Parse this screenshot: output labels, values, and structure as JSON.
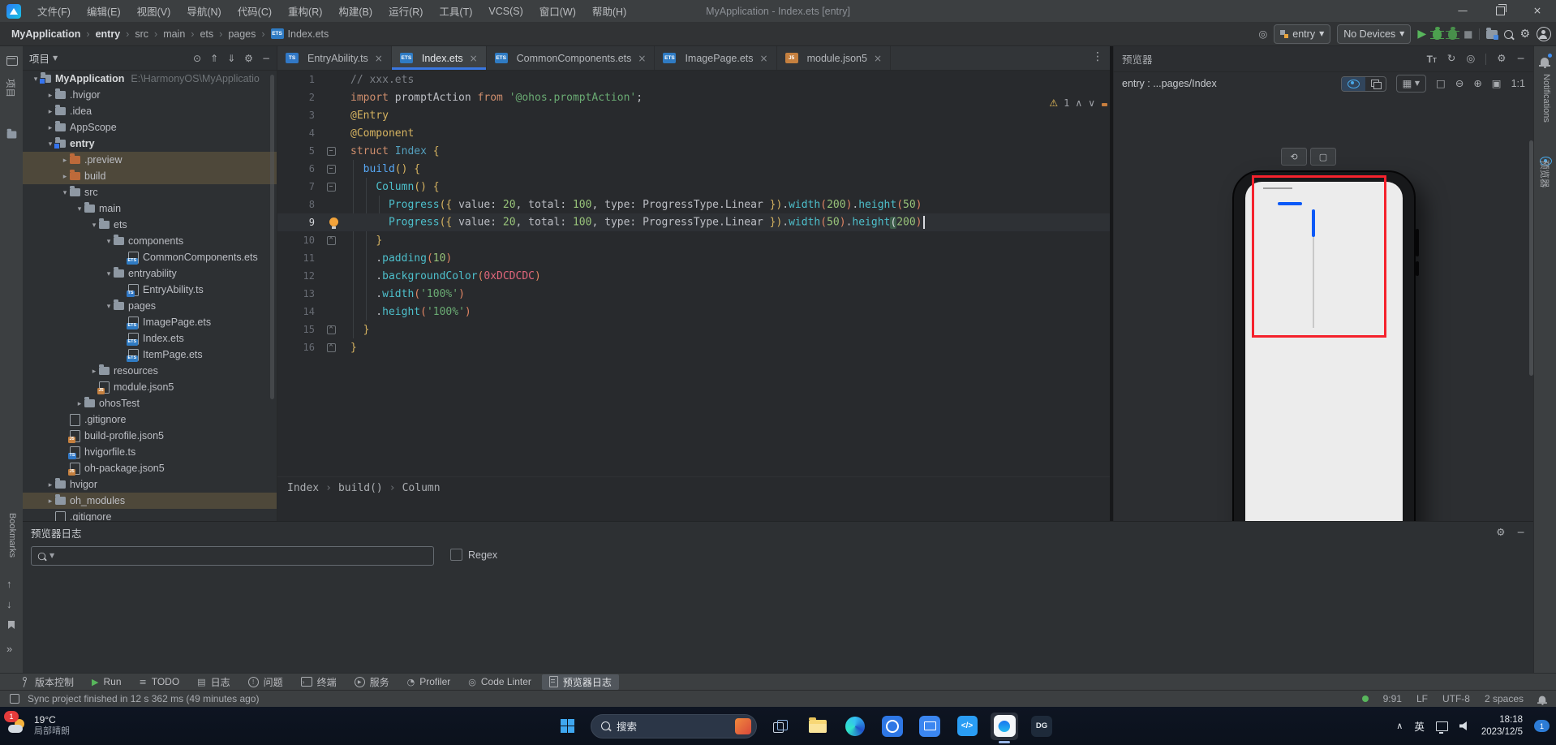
{
  "window": {
    "title": "MyApplication - Index.ets [entry]"
  },
  "menu": {
    "items": [
      "文件(F)",
      "编辑(E)",
      "视图(V)",
      "导航(N)",
      "代码(C)",
      "重构(R)",
      "构建(B)",
      "运行(R)",
      "工具(T)",
      "VCS(S)",
      "窗口(W)",
      "帮助(H)"
    ]
  },
  "toolbar": {
    "module": "entry",
    "device": "No Devices"
  },
  "breadcrumbs": {
    "items": [
      "MyApplication",
      "entry",
      "src",
      "main",
      "ets",
      "pages",
      "Index.ets"
    ]
  },
  "left_strip": {
    "project_label": "项目",
    "bookmarks_label": "Bookmarks"
  },
  "right_strip": {
    "notifications_label": "Notifications",
    "previewer_label": "预览器"
  },
  "project": {
    "header": "项目",
    "items": [
      {
        "label": "MyApplication",
        "indent": 0,
        "chev": "open",
        "icon": "folder-module",
        "bold": true,
        "path": "E:\\HarmonyOS\\MyApplicatio"
      },
      {
        "label": ".hvigor",
        "indent": 1,
        "chev": "closed",
        "icon": "folder"
      },
      {
        "label": ".idea",
        "indent": 1,
        "chev": "closed",
        "icon": "folder"
      },
      {
        "label": "AppScope",
        "indent": 1,
        "chev": "closed",
        "icon": "folder"
      },
      {
        "label": "entry",
        "indent": 1,
        "chev": "open",
        "icon": "folder-module",
        "bold": true
      },
      {
        "label": ".preview",
        "indent": 2,
        "chev": "closed",
        "icon": "folder-orange",
        "sel": true
      },
      {
        "label": "build",
        "indent": 2,
        "chev": "closed",
        "icon": "folder-orange",
        "sel": true
      },
      {
        "label": "src",
        "indent": 2,
        "chev": "open",
        "icon": "folder"
      },
      {
        "label": "main",
        "indent": 3,
        "chev": "open",
        "icon": "folder"
      },
      {
        "label": "ets",
        "indent": 4,
        "chev": "open",
        "icon": "folder"
      },
      {
        "label": "components",
        "indent": 5,
        "chev": "open",
        "icon": "folder"
      },
      {
        "label": "CommonComponents.ets",
        "indent": 6,
        "chev": null,
        "icon": "file-ets"
      },
      {
        "label": "entryability",
        "indent": 5,
        "chev": "open",
        "icon": "folder"
      },
      {
        "label": "EntryAbility.ts",
        "indent": 6,
        "chev": null,
        "icon": "file-ts"
      },
      {
        "label": "pages",
        "indent": 5,
        "chev": "open",
        "icon": "folder"
      },
      {
        "label": "ImagePage.ets",
        "indent": 6,
        "chev": null,
        "icon": "file-ets"
      },
      {
        "label": "Index.ets",
        "indent": 6,
        "chev": null,
        "icon": "file-ets"
      },
      {
        "label": "ItemPage.ets",
        "indent": 6,
        "chev": null,
        "icon": "file-ets"
      },
      {
        "label": "resources",
        "indent": 4,
        "chev": "closed",
        "icon": "folder"
      },
      {
        "label": "module.json5",
        "indent": 4,
        "chev": null,
        "icon": "file-json"
      },
      {
        "label": "ohosTest",
        "indent": 3,
        "chev": "closed",
        "icon": "folder"
      },
      {
        "label": ".gitignore",
        "indent": 2,
        "chev": null,
        "icon": "file-plain"
      },
      {
        "label": "build-profile.json5",
        "indent": 2,
        "chev": null,
        "icon": "file-json"
      },
      {
        "label": "hvigorfile.ts",
        "indent": 2,
        "chev": null,
        "icon": "file-ts"
      },
      {
        "label": "oh-package.json5",
        "indent": 2,
        "chev": null,
        "icon": "file-json"
      },
      {
        "label": "hvigor",
        "indent": 1,
        "chev": "closed",
        "icon": "folder"
      },
      {
        "label": "oh_modules",
        "indent": 1,
        "chev": "closed",
        "icon": "folder",
        "sel": true
      },
      {
        "label": ".gitignore",
        "indent": 1,
        "chev": null,
        "icon": "file-plain"
      }
    ]
  },
  "tabs": {
    "items": [
      {
        "label": "EntryAbility.ts",
        "icon": "ts",
        "active": false
      },
      {
        "label": "Index.ets",
        "icon": "ets",
        "active": true
      },
      {
        "label": "CommonComponents.ets",
        "icon": "ets",
        "active": false
      },
      {
        "label": "ImagePage.ets",
        "icon": "ets",
        "active": false
      },
      {
        "label": "module.json5",
        "icon": "json",
        "active": false
      }
    ]
  },
  "editor": {
    "warning_count": "1",
    "breadcrumb": [
      "Index",
      "build()",
      "Column"
    ],
    "lines": [
      {
        "n": 1,
        "t": [
          [
            "c",
            "// xxx.ets"
          ]
        ]
      },
      {
        "n": 2,
        "t": [
          [
            "k",
            "import"
          ],
          [
            "d",
            " promptAction "
          ],
          [
            "k",
            "from"
          ],
          [
            "d",
            " "
          ],
          [
            "s",
            "'@ohos.promptAction'"
          ],
          [
            "d",
            ";"
          ]
        ]
      },
      {
        "n": 3,
        "t": [
          [
            "a",
            "@Entry"
          ]
        ]
      },
      {
        "n": 4,
        "t": [
          [
            "a",
            "@Component"
          ]
        ]
      },
      {
        "n": 5,
        "fold": "minus",
        "t": [
          [
            "k",
            "struct"
          ],
          [
            "d",
            " "
          ],
          [
            "t",
            "Index"
          ],
          [
            "d",
            " "
          ],
          [
            "g",
            "{"
          ]
        ]
      },
      {
        "n": 6,
        "fold": "minus",
        "t": [
          [
            "d",
            "  "
          ],
          [
            "f",
            "build"
          ],
          [
            "g",
            "()"
          ],
          [
            "d",
            " "
          ],
          [
            "g",
            "{"
          ]
        ]
      },
      {
        "n": 7,
        "fold": "minus",
        "t": [
          [
            "d",
            "    "
          ],
          [
            "m",
            "Column"
          ],
          [
            "g",
            "()"
          ],
          [
            "d",
            " "
          ],
          [
            "g",
            "{"
          ]
        ]
      },
      {
        "n": 8,
        "t": [
          [
            "d",
            "      "
          ],
          [
            "m",
            "Progress"
          ],
          [
            "g",
            "({"
          ],
          [
            "d",
            " value: "
          ],
          [
            "n",
            "20"
          ],
          [
            "d",
            ", total: "
          ],
          [
            "n",
            "100"
          ],
          [
            "d",
            ", type: ProgressType.Linear "
          ],
          [
            "g",
            "})"
          ],
          [
            "d",
            "."
          ],
          [
            "m",
            "width"
          ],
          [
            "p",
            "("
          ],
          [
            "n",
            "200"
          ],
          [
            "p",
            ")"
          ],
          [
            "d",
            "."
          ],
          [
            "m",
            "height"
          ],
          [
            "p",
            "("
          ],
          [
            "n",
            "50"
          ],
          [
            "p",
            ")"
          ]
        ]
      },
      {
        "n": 9,
        "cur": true,
        "bulb": true,
        "caret": true,
        "t": [
          [
            "d",
            "      "
          ],
          [
            "m",
            "Progress"
          ],
          [
            "g",
            "({"
          ],
          [
            "d",
            " value: "
          ],
          [
            "n",
            "20"
          ],
          [
            "d",
            ", total: "
          ],
          [
            "n",
            "100"
          ],
          [
            "d",
            ", type: ProgressType.Linear "
          ],
          [
            "g",
            "})"
          ],
          [
            "d",
            "."
          ],
          [
            "m",
            "width"
          ],
          [
            "p",
            "("
          ],
          [
            "n",
            "50"
          ],
          [
            "p",
            ")"
          ],
          [
            "d",
            "."
          ],
          [
            "m",
            "height"
          ],
          [
            "M",
            "("
          ],
          [
            "n",
            "200"
          ],
          [
            "p",
            ")"
          ]
        ]
      },
      {
        "n": 10,
        "fold": "end",
        "t": [
          [
            "d",
            "    "
          ],
          [
            "g",
            "}"
          ]
        ]
      },
      {
        "n": 11,
        "t": [
          [
            "d",
            "    ."
          ],
          [
            "m",
            "padding"
          ],
          [
            "p",
            "("
          ],
          [
            "n",
            "10"
          ],
          [
            "p",
            ")"
          ]
        ]
      },
      {
        "n": 12,
        "t": [
          [
            "d",
            "    ."
          ],
          [
            "m",
            "backgroundColor"
          ],
          [
            "p",
            "("
          ],
          [
            "h",
            "0xDCDCDC"
          ],
          [
            "p",
            ")"
          ]
        ]
      },
      {
        "n": 13,
        "t": [
          [
            "d",
            "    ."
          ],
          [
            "m",
            "width"
          ],
          [
            "p",
            "("
          ],
          [
            "s",
            "'100%'"
          ],
          [
            "p",
            ")"
          ]
        ]
      },
      {
        "n": 14,
        "t": [
          [
            "d",
            "    ."
          ],
          [
            "m",
            "height"
          ],
          [
            "p",
            "("
          ],
          [
            "s",
            "'100%'"
          ],
          [
            "p",
            ")"
          ]
        ]
      },
      {
        "n": 15,
        "fold": "end",
        "t": [
          [
            "d",
            "  "
          ],
          [
            "g",
            "}"
          ]
        ]
      },
      {
        "n": 16,
        "fold": "end",
        "t": [
          [
            "g",
            "}"
          ]
        ]
      }
    ]
  },
  "previewer": {
    "title": "预览器",
    "target": "entry : ...pages/Index",
    "ratio": "1:1",
    "phone": {
      "screen_color": "#ECECEC",
      "progress_color": "#0A59F7",
      "track_color": "#C8C8C8",
      "highlight_color": "#F5222D"
    }
  },
  "bottom": {
    "title": "预览器日志",
    "regex_label": "Regex",
    "search_placeholder": ""
  },
  "toolwindows": {
    "items": [
      {
        "label": "版本控制",
        "icon": "branch"
      },
      {
        "label": "Run",
        "icon": "play"
      },
      {
        "label": "TODO",
        "icon": "todo"
      },
      {
        "label": "日志",
        "icon": "log"
      },
      {
        "label": "问题",
        "icon": "problem"
      },
      {
        "label": "终端",
        "icon": "terminal"
      },
      {
        "label": "服务",
        "icon": "service"
      },
      {
        "label": "Profiler",
        "icon": "gauge"
      },
      {
        "label": "Code Linter",
        "icon": "linter"
      },
      {
        "label": "预览器日志",
        "icon": "page",
        "active": true
      }
    ]
  },
  "status": {
    "message": "Sync project finished in 12 s 362 ms (49 minutes ago)",
    "segments": [
      "9:91",
      "LF",
      "UTF-8",
      "2 spaces"
    ]
  },
  "taskbar": {
    "weather": {
      "badge": "1",
      "temp": "19°C",
      "desc": "局部晴朗"
    },
    "search_label": "搜索",
    "apps": [
      {
        "name": "task-view"
      },
      {
        "name": "file-explorer"
      },
      {
        "name": "edge"
      },
      {
        "name": "app-blue-1"
      },
      {
        "name": "app-blue-2"
      },
      {
        "name": "vscode"
      },
      {
        "name": "deveco",
        "active": true
      },
      {
        "name": "dg",
        "label": "DG"
      }
    ],
    "lang": "英",
    "time": "18:18",
    "date": "2023/12/5",
    "notif_badge": "1"
  }
}
